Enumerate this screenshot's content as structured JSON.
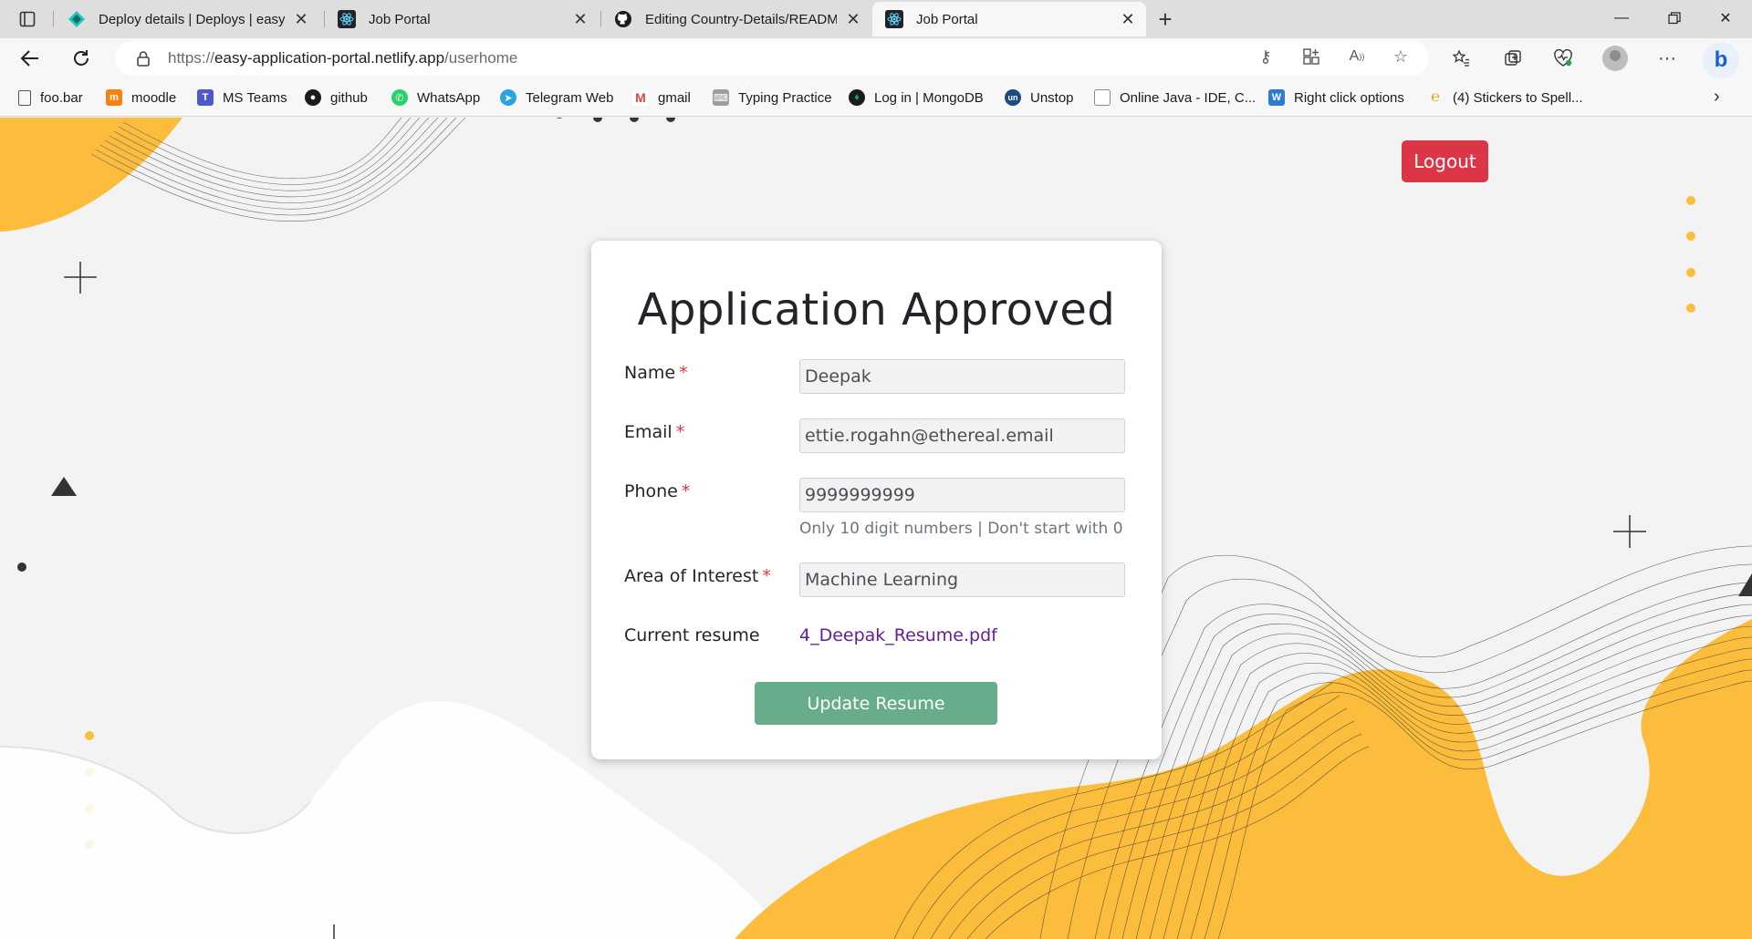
{
  "browser": {
    "tabs": [
      {
        "title": "Deploy details | Deploys | easy-ap",
        "icon": "netlify-icon"
      },
      {
        "title": "Job Portal",
        "icon": "react-icon"
      },
      {
        "title": "Editing Country-Details/README",
        "icon": "github-icon"
      },
      {
        "title": "Job Portal",
        "icon": "react-icon"
      }
    ],
    "url_prefix": "https://",
    "url_host": "easy-application-portal.netlify.app",
    "url_path": "/userhome",
    "bookmarks": [
      {
        "label": "foo.bar",
        "icon": "document-icon",
        "color": "#555555"
      },
      {
        "label": "moodle",
        "icon": "moodle-icon",
        "color": "#f98012"
      },
      {
        "label": "MS Teams",
        "icon": "teams-icon",
        "color": "#5059c9"
      },
      {
        "label": "github",
        "icon": "github-icon",
        "color": "#1b1b1b"
      },
      {
        "label": "WhatsApp",
        "icon": "whatsapp-icon",
        "color": "#25d366"
      },
      {
        "label": "Telegram Web",
        "icon": "telegram-icon",
        "color": "#2aa3df"
      },
      {
        "label": "gmail",
        "icon": "gmail-icon",
        "color": "#ea4335"
      },
      {
        "label": "Typing Practice",
        "icon": "typing-icon",
        "color": "#777777"
      },
      {
        "label": "Log in | MongoDB",
        "icon": "mongodb-icon",
        "color": "#13aa52"
      },
      {
        "label": "Unstop",
        "icon": "unstop-icon",
        "color": "#1c4980"
      },
      {
        "label": "Online Java - IDE, C...",
        "icon": "java-icon",
        "color": "#e76f00"
      },
      {
        "label": "Right click options",
        "icon": "word-icon",
        "color": "#2b7cd3"
      },
      {
        "label": "(4) Stickers to Spell...",
        "icon": "sticker-icon",
        "color": "#e0a000"
      }
    ]
  },
  "page": {
    "logout_label": "Logout",
    "title": "Application Approved",
    "fields": {
      "name": {
        "label": "Name",
        "required": "*",
        "value": "Deepak"
      },
      "email": {
        "label": "Email",
        "required": "*",
        "value": "ettie.rogahn@ethereal.email"
      },
      "phone": {
        "label": "Phone",
        "required": "*",
        "value": "9999999999",
        "hint": "Only 10 digit numbers | Don't start with 0"
      },
      "interest": {
        "label": "Area of Interest",
        "required": "*",
        "value": "Machine Learning"
      }
    },
    "resume": {
      "label": "Current resume",
      "file": "4_Deepak_Resume.pdf"
    },
    "update_label": "Update Resume"
  },
  "colors": {
    "accent_yellow": "#fbbd3b",
    "logout_red": "#dc3545",
    "update_green": "#67ad8b",
    "link_purple": "#6a1b9a"
  }
}
